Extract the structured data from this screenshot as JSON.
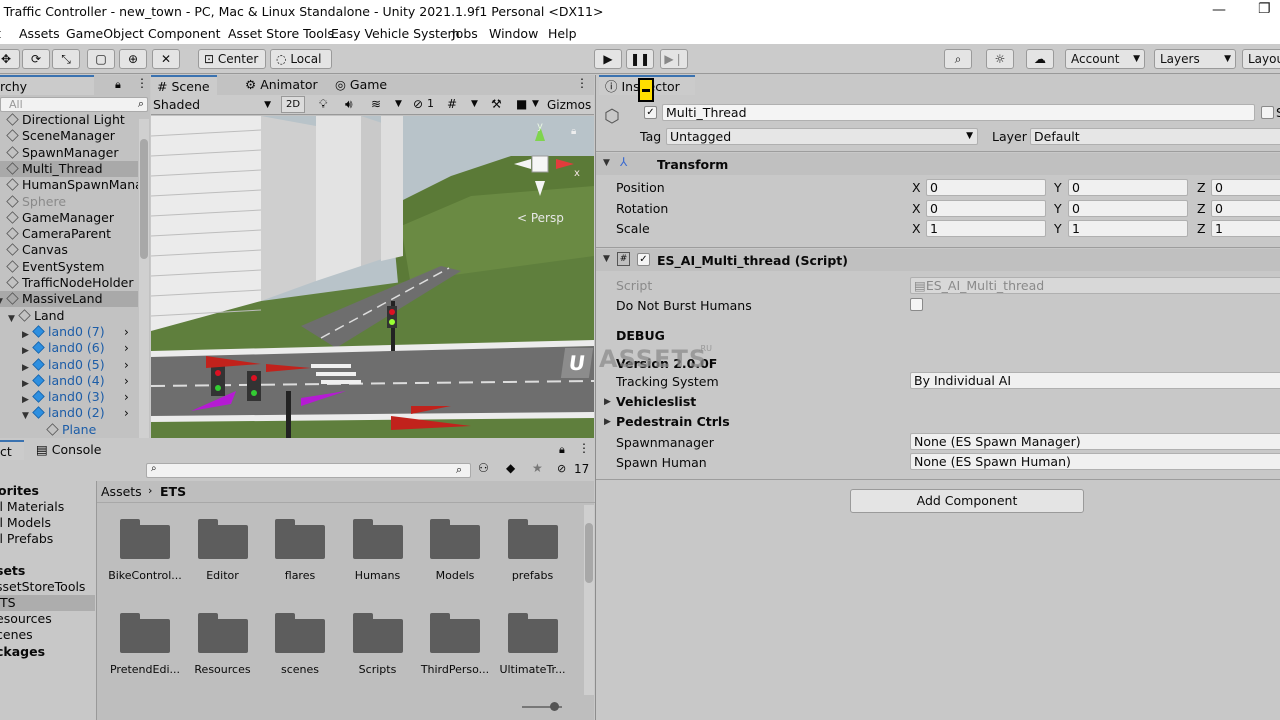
{
  "window": {
    "title": "e Traffic Controller - new_town - PC, Mac & Linux Standalone - Unity 2021.1.9f1 Personal <DX11>"
  },
  "menu": [
    "t",
    "Assets",
    "GameObject",
    "Component",
    "Asset Store Tools",
    "Easy Vehicle System",
    "Jobs",
    "Window",
    "Help"
  ],
  "toolbar": {
    "pivot_label": "Center",
    "space_label": "Local",
    "account_label": "Account",
    "layers_label": "Layers",
    "layout_label": "Layou"
  },
  "hierarchy": {
    "tab_label": "rchy",
    "search_placeholder": "All",
    "items": [
      {
        "label": "Directional Light",
        "style": "normal"
      },
      {
        "label": "SceneManager",
        "style": "normal"
      },
      {
        "label": "SpawnManager",
        "style": "normal"
      },
      {
        "label": "Multi_Thread",
        "style": "selected"
      },
      {
        "label": "HumanSpawnMana",
        "style": "normal"
      },
      {
        "label": "Sphere",
        "style": "disabled"
      },
      {
        "label": "GameManager",
        "style": "normal"
      },
      {
        "label": "CameraParent",
        "style": "normal"
      },
      {
        "label": "Canvas",
        "style": "normal"
      },
      {
        "label": "EventSystem",
        "style": "normal"
      },
      {
        "label": "TrafficNodeHolder",
        "style": "normal"
      },
      {
        "label": "MassiveLand",
        "style": "normal"
      },
      {
        "label": "Land",
        "style": "normal"
      },
      {
        "label": "land0 (7)",
        "style": "prefab"
      },
      {
        "label": "land0 (6)",
        "style": "prefab"
      },
      {
        "label": "land0 (5)",
        "style": "prefab"
      },
      {
        "label": "land0 (4)",
        "style": "prefab"
      },
      {
        "label": "land0 (3)",
        "style": "prefab"
      },
      {
        "label": "land0 (2)",
        "style": "prefab"
      },
      {
        "label": "Plane",
        "style": "prefab"
      }
    ]
  },
  "scene": {
    "tabs": [
      "Scene",
      "Animator",
      "Game"
    ],
    "shading_mode": "Shaded",
    "mode_2d": "2D",
    "hidden_count": "1",
    "gizmos_label": "Gizmos",
    "persp_label": "< Persp"
  },
  "project": {
    "tabs": [
      "ct",
      "Console"
    ],
    "hidden_count": "17",
    "favorites": {
      "header": "orites",
      "items": [
        "ll Materials",
        "ll Models",
        "ll Prefabs"
      ]
    },
    "assets_tree": {
      "header": "sets",
      "items": [
        "ssetStoreTools",
        "TS",
        "esources",
        "cenes"
      ]
    },
    "packages_header": "ckages",
    "breadcrumb": [
      "Assets",
      "ETS"
    ],
    "folders": [
      "BikeControl...",
      "Editor",
      "flares",
      "Humans",
      "Models",
      "prefabs",
      "PretendEdi...",
      "Resources",
      "scenes",
      "Scripts",
      "ThirdPerso...",
      "UltimateTr..."
    ]
  },
  "inspector": {
    "tab_label": "Inspector",
    "object_name": "Multi_Thread",
    "static_label": "S",
    "tag_label": "Tag",
    "tag_value": "Untagged",
    "layer_label": "Layer",
    "layer_value": "Default",
    "transform": {
      "header": "Transform",
      "rows": [
        {
          "label": "Position",
          "x": "0",
          "y": "0",
          "z": "0"
        },
        {
          "label": "Rotation",
          "x": "0",
          "y": "0",
          "z": "0"
        },
        {
          "label": "Scale",
          "x": "1",
          "y": "1",
          "z": "1"
        }
      ],
      "axis_x": "X",
      "axis_y": "Y",
      "axis_z": "Z"
    },
    "script_component": {
      "header": "ES_AI_Multi_thread (Script)",
      "script_label": "Script",
      "script_value": "ES_AI_Multi_thread",
      "burst_label": "Do Not Burst Humans",
      "debug_label": "DEBUG",
      "version_label": "Version 2.0.0F",
      "tracking_label": "Tracking System",
      "tracking_value": "By Individual AI",
      "vehicles_label": "Vehicleslist",
      "pedestrian_label": "Pedestrain Ctrls",
      "spawnmanager_label": "Spawnmanager",
      "spawnmanager_value": "None (ES Spawn Manager)",
      "spawnhuman_label": "Spawn Human",
      "spawnhuman_value": "None (ES Spawn Human)"
    },
    "add_component_label": "Add Component"
  },
  "watermark": {
    "text1": "U",
    "text2": "ASSETS",
    "suffix": ".RU"
  }
}
